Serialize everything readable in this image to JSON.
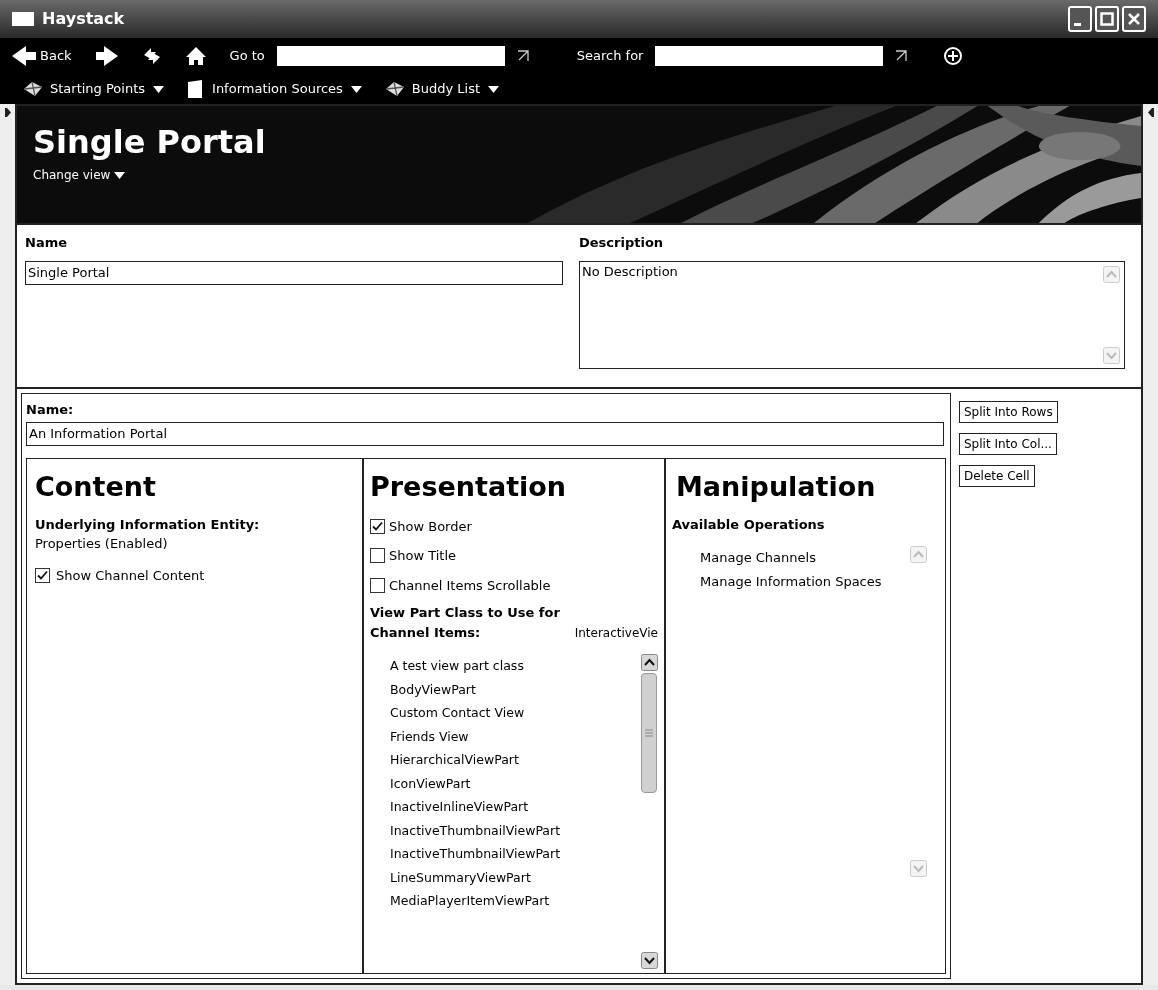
{
  "window": {
    "title": "Haystack"
  },
  "toolbar": {
    "back": "Back",
    "go_to": "Go to",
    "search_for": "Search for"
  },
  "menus": [
    {
      "label": "Starting Points",
      "kind": "gem"
    },
    {
      "label": "Information Sources",
      "kind": "page"
    },
    {
      "label": "Buddy List",
      "kind": "gem"
    }
  ],
  "header": {
    "title": "Single Portal",
    "change_view": "Change view"
  },
  "properties": {
    "name_label": "Name",
    "name_value": "Single Portal",
    "description_label": "Description",
    "description_value": "No Description"
  },
  "cell": {
    "name_label": "Name:",
    "name_value": "An Information Portal",
    "buttons": [
      "Split Into Rows",
      "Split Into Col...",
      "Delete Cell"
    ]
  },
  "content": {
    "title": "Content",
    "entity_label": "Underlying Information Entity:",
    "entity_value": "Properties (Enabled)",
    "checkboxes": [
      {
        "label": "Show Channel Content",
        "checked": true
      }
    ]
  },
  "presentation": {
    "title": "Presentation",
    "checkboxes": [
      {
        "label": "Show Border",
        "checked": true
      },
      {
        "label": "Show Title",
        "checked": false
      },
      {
        "label": "Channel Items Scrollable",
        "checked": false
      }
    ],
    "class_label": "View Part Class to Use for Channel Items:",
    "class_value": "InteractiveVie",
    "classes": [
      "A test view part class",
      "BodyViewPart",
      "Custom Contact View",
      "Friends View",
      "HierarchicalViewPart",
      "IconViewPart",
      "InactiveInlineViewPart",
      "InactiveThumbnailViewPart",
      "InactiveThumbnailViewPart",
      "LineSummaryViewPart",
      "MediaPlayerItemViewPart"
    ]
  },
  "manipulation": {
    "title": "Manipulation",
    "operations_label": "Available Operations",
    "operations": [
      "Manage Channels",
      "Manage Information Spaces"
    ]
  }
}
